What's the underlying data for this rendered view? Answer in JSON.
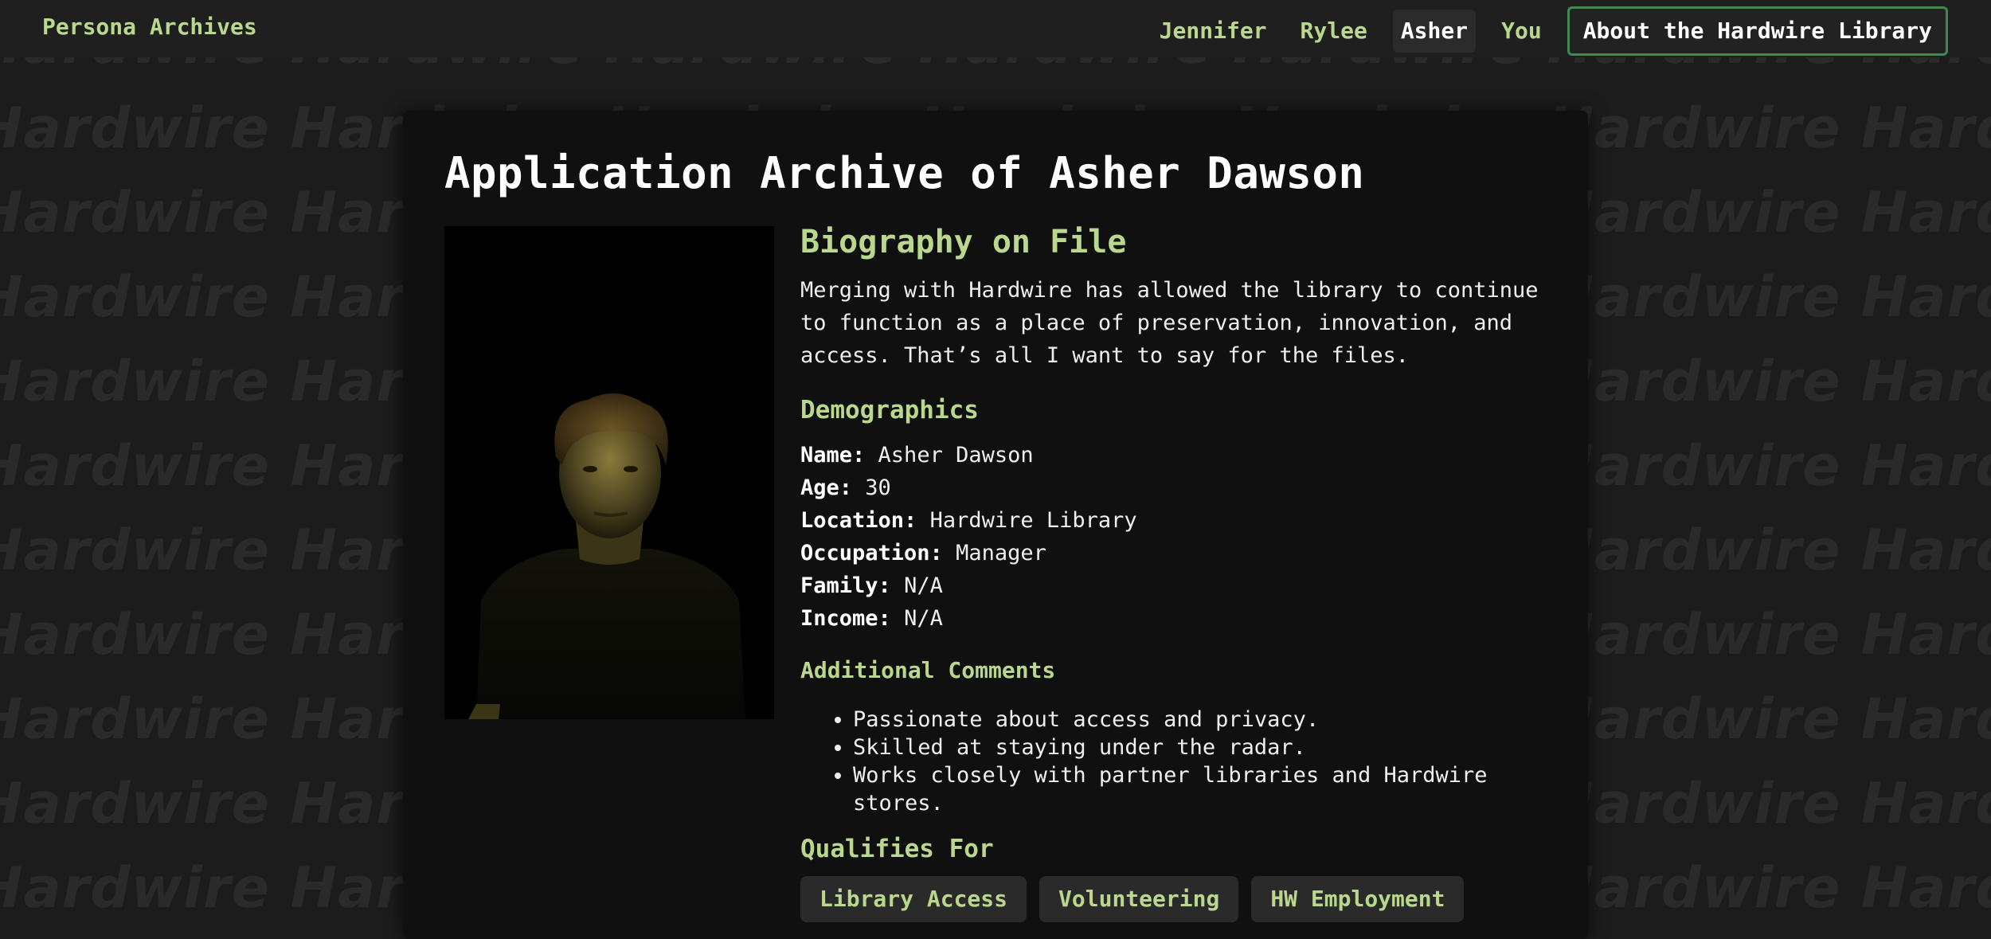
{
  "nav": {
    "brand": "Persona Archives",
    "links": [
      {
        "label": "Jennifer",
        "active": false
      },
      {
        "label": "Rylee",
        "active": false
      },
      {
        "label": "Asher",
        "active": true
      },
      {
        "label": "You",
        "active": false
      }
    ],
    "cta": "About the Hardwire Library"
  },
  "background": {
    "pattern_word": "Hardwire"
  },
  "profile": {
    "title": "Application Archive of Asher Dawson",
    "photo_alt": "Portrait of Asher Dawson",
    "bio_heading": "Biography on File",
    "bio_text": "Merging with Hardwire has allowed the library to continue to function as a place of preservation, innovation, and access. That’s all I want to say for the files.",
    "demographics_heading": "Demographics",
    "demographics": [
      {
        "label": "Name:",
        "value": "Asher Dawson"
      },
      {
        "label": "Age:",
        "value": "30"
      },
      {
        "label": "Location:",
        "value": "Hardwire Library"
      },
      {
        "label": "Occupation:",
        "value": "Manager"
      },
      {
        "label": "Family:",
        "value": "N/A"
      },
      {
        "label": "Income:",
        "value": "N/A"
      }
    ],
    "comments_heading": "Additional Comments",
    "comments": [
      "Passionate about access and privacy.",
      "Skilled at staying under the radar.",
      "Works closely with partner libraries and Hardwire stores."
    ],
    "qualifies_heading": "Qualifies For",
    "qualifies": [
      "Library Access",
      "Volunteering",
      "HW Employment"
    ]
  },
  "colors": {
    "accent": "#b9d88e",
    "background": "#1c1c1c",
    "card": "#101010",
    "cta_border": "#3f8a52"
  }
}
